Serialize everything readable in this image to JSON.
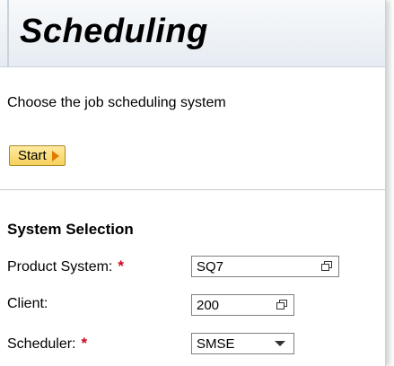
{
  "header": {
    "title": "Scheduling"
  },
  "main": {
    "description": "Choose the job scheduling system",
    "start_button_label": "Start"
  },
  "system_selection": {
    "section_title": "System Selection",
    "product_system": {
      "label": "Product System:",
      "required_mark": "*",
      "value": "SQ7",
      "icon": "value-help-icon"
    },
    "client": {
      "label": "Client:",
      "value": "200",
      "icon": "value-help-icon"
    },
    "scheduler": {
      "label": "Scheduler:",
      "required_mark": "*",
      "value": "SMSE",
      "icon": "chevron-down-icon"
    }
  },
  "colors": {
    "button_bg": "#f6d15c",
    "button_arrow": "#e07b00",
    "required": "#d0021b",
    "title_bar": "#e6ecf2"
  }
}
